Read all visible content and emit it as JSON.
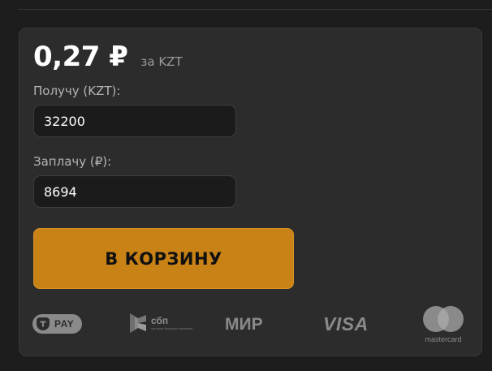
{
  "offer": {
    "price": "0,27 ₽",
    "per_unit": "за KZT"
  },
  "receive": {
    "label": "Получу (KZT):",
    "value": "32200"
  },
  "pay": {
    "label": "Заплачу (₽):",
    "value": "8694"
  },
  "cart_button": {
    "label": "В КОРЗИНУ"
  },
  "payment_methods": {
    "tpay": "PAY",
    "sbp": "сбп",
    "sbp_sub": "система быстрых платежей",
    "mir": "МИР",
    "visa": "VISA",
    "mastercard": "mastercard"
  },
  "colors": {
    "background": "#1d1d1d",
    "card": "#2c2c2c",
    "accent": "#c98215",
    "input_bg": "#1b1b1b",
    "logo_gray": "#8a8a8a"
  }
}
